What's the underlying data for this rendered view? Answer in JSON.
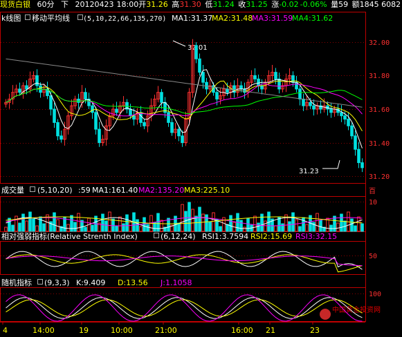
{
  "header": {
    "symbol": "现货白银",
    "period": "60分",
    "dir": "下",
    "date": "20120423",
    "time": "18:00",
    "open_label": "开",
    "open": "31.26",
    "high_label": "高",
    "high": "31.30",
    "low_label": "低",
    "low": "31.24",
    "close_label": "收",
    "close": "31.25",
    "chg_label": "涨",
    "chg": "-0.02",
    "chg_pct": "-0.06%",
    "vol_label": "量",
    "vol": "59",
    "amt_label": "额",
    "amt": "1845 6082"
  },
  "main": {
    "tab": "k线图",
    "indicator": "移动平均线",
    "params": "(5,10,22,66,135,270)",
    "ma1": "MA1:31.37",
    "ma2": "MA2:31.48",
    "ma3": "MA3:31.59",
    "ma4": "MA4:31.62",
    "hi_annot": "32.01",
    "lo_annot": "31.23",
    "yticks": [
      "32.00",
      "31.80",
      "31.60",
      "31.40",
      "31.20"
    ]
  },
  "vol": {
    "name": "成交量",
    "params": "(5,10,20)",
    "val": ":59",
    "ma1": "MA1:161.40",
    "ma2": "MA2:135.20",
    "ma3": "MA3:225.10",
    "ytick": "10",
    "unit": "百"
  },
  "rsi": {
    "name": "相对强弱指标(Relative Strenth Index)",
    "params": "(6,12,24)",
    "r1": "RSI1:3.7594",
    "r2": "RSI2:15.69",
    "r3": "RSI3:32.15",
    "ytick": "50"
  },
  "kdj": {
    "name": "随机指标",
    "params": "(9,3,3)",
    "k": "K:9.409",
    "d": "D:13.56",
    "j": "J:1.1058",
    "ytick": "100"
  },
  "xaxis": [
    "4",
    "14:00",
    "19",
    "10:00",
    "21:00",
    "16:00",
    "21",
    "23"
  ],
  "watermark": "中国黄金投资网",
  "colors": {
    "up": "#ff3030",
    "down": "#00e0e0",
    "ma1": "#ffffff",
    "ma2": "#ffff00",
    "ma3": "#ff00ff",
    "ma4": "#00ff00",
    "grid": "#8b0000",
    "axis": "#c00000"
  }
}
